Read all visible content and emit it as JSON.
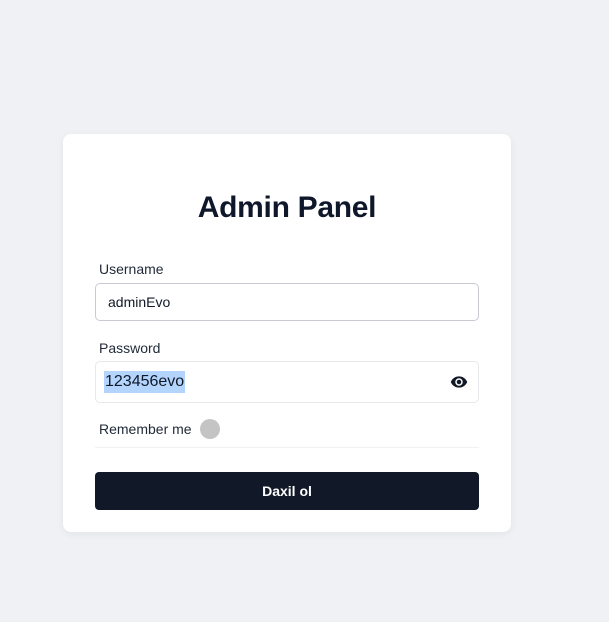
{
  "title": "Admin Panel",
  "username": {
    "label": "Username",
    "value": "adminEvo"
  },
  "password": {
    "label": "Password",
    "value": "123456evo",
    "toggle_icon": "eye-icon"
  },
  "remember": {
    "label": "Remember me",
    "checked": false
  },
  "submit": {
    "label": "Daxil ol"
  },
  "colors": {
    "background": "#eff1f5",
    "card": "#ffffff",
    "button": "#111827",
    "selection": "#b3d4fc",
    "toggle_off": "#c4c4c4"
  }
}
